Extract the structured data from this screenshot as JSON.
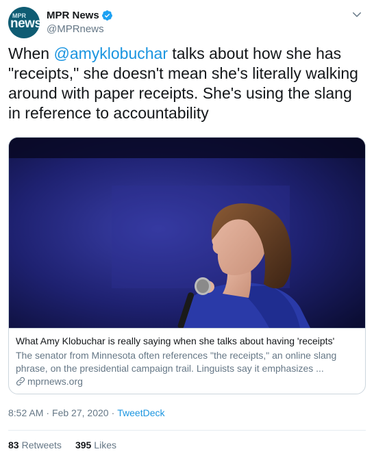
{
  "account": {
    "avatar_top_text": "MPR",
    "avatar_main_text": "news",
    "display_name": "MPR News",
    "handle": "@MPRnews",
    "verified": true
  },
  "tweet": {
    "text_before_mention": "When ",
    "mention": "@amyklobuchar",
    "text_after_mention": " talks about how she has \"receipts,\" she doesn't mean she's literally walking around with paper receipts. She's using the slang in reference to accountability"
  },
  "card": {
    "image_subject": "photo of a woman speaking into a microphone against a blue background",
    "title": "What Amy Klobuchar is really saying when she talks about having 'receipts'",
    "description": "The senator from Minnesota often references \"the receipts,\" an online slang phrase, on the presidential campaign trail. Linguists say it emphasizes ...",
    "domain": "mprnews.org"
  },
  "meta": {
    "time": "8:52 AM",
    "date": "Feb 27, 2020",
    "separator": "·",
    "source": "TweetDeck"
  },
  "stats": {
    "retweets_count": "83",
    "retweets_label": "Retweets",
    "likes_count": "395",
    "likes_label": "Likes"
  },
  "colors": {
    "accent": "#1b95e0",
    "verified_badge": "#1da1f2",
    "secondary_text": "#657786",
    "border": "#ccd6dd"
  }
}
